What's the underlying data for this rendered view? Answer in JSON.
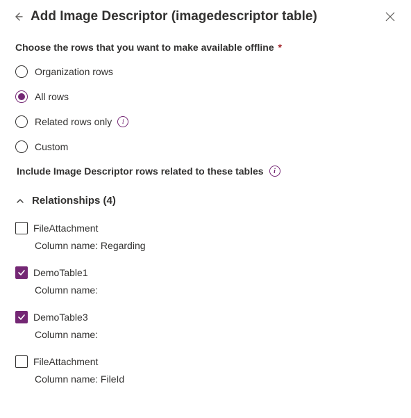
{
  "header": {
    "title": "Add Image Descriptor (imagedescriptor table)"
  },
  "prompt": "Choose the rows that you want to make available offline",
  "required_marker": "*",
  "options": [
    {
      "label": "Organization rows",
      "selected": false,
      "info": false
    },
    {
      "label": "All rows",
      "selected": true,
      "info": false
    },
    {
      "label": "Related rows only",
      "selected": false,
      "info": true
    },
    {
      "label": "Custom",
      "selected": false,
      "info": false
    }
  ],
  "subhead": "Include Image Descriptor rows related to these tables",
  "relationships": {
    "title": "Relationships (4)",
    "items": [
      {
        "name": "FileAttachment",
        "column_label": "Column name: Regarding",
        "checked": false
      },
      {
        "name": "DemoTable1",
        "column_label": "Column name:",
        "checked": true
      },
      {
        "name": "DemoTable3",
        "column_label": "Column name:",
        "checked": true
      },
      {
        "name": "FileAttachment",
        "column_label": "Column name: FileId",
        "checked": false
      }
    ]
  }
}
